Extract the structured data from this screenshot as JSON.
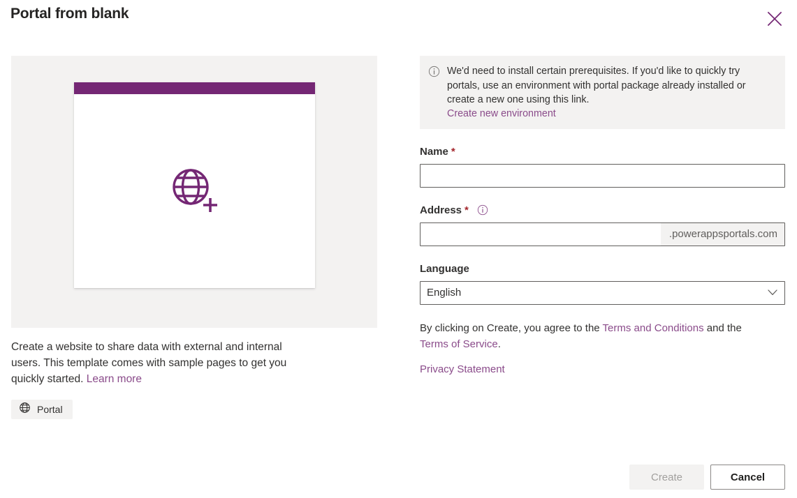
{
  "dialog": {
    "title": "Portal from blank",
    "close_icon": "close-icon"
  },
  "left_panel": {
    "preview": {
      "icon": "globe-add-icon",
      "titlebar_color": "#742774",
      "surface_color": "#f3f2f1"
    },
    "description": {
      "line": "Create a website to share data with external and internal users. This template comes with sample pages to get you quickly started.",
      "learn_more_label": "Learn more"
    },
    "tag": {
      "icon": "globe-icon",
      "label": "Portal"
    }
  },
  "right_panel": {
    "info_banner": {
      "icon": "info-circle-icon",
      "message": "We'd need to install certain prerequisites. If you'd like to quickly try portals, use an environment with portal package already installed or create a new one using this link.",
      "link_label": "Create new environment"
    },
    "name_field": {
      "label": "Name",
      "required_marker": "*",
      "value": "",
      "placeholder": ""
    },
    "address_field": {
      "label": "Address",
      "required_marker": "*",
      "info_icon": "info-circle-icon",
      "value": "",
      "placeholder": "",
      "suffix": ".powerappsportals.com"
    },
    "language_field": {
      "label": "Language",
      "selected": "English",
      "options": [
        "English"
      ],
      "chevron_icon": "chevron-down-icon"
    },
    "legal": {
      "prefix": "By clicking on Create, you agree to the ",
      "terms_and_conditions_label": "Terms and Conditions",
      "middle": " and the ",
      "terms_of_service_label": "Terms of Service",
      "suffix": ".",
      "privacy_statement_label": "Privacy Statement"
    }
  },
  "footer": {
    "create_label": "Create",
    "cancel_label": "Cancel"
  },
  "colors": {
    "accent_purple": "#742774",
    "link_purple": "#8a4b8a",
    "required_red": "#a4262c",
    "neutral_light": "#f3f2f1",
    "border_grey": "#605e5c",
    "text_primary": "#323130"
  }
}
